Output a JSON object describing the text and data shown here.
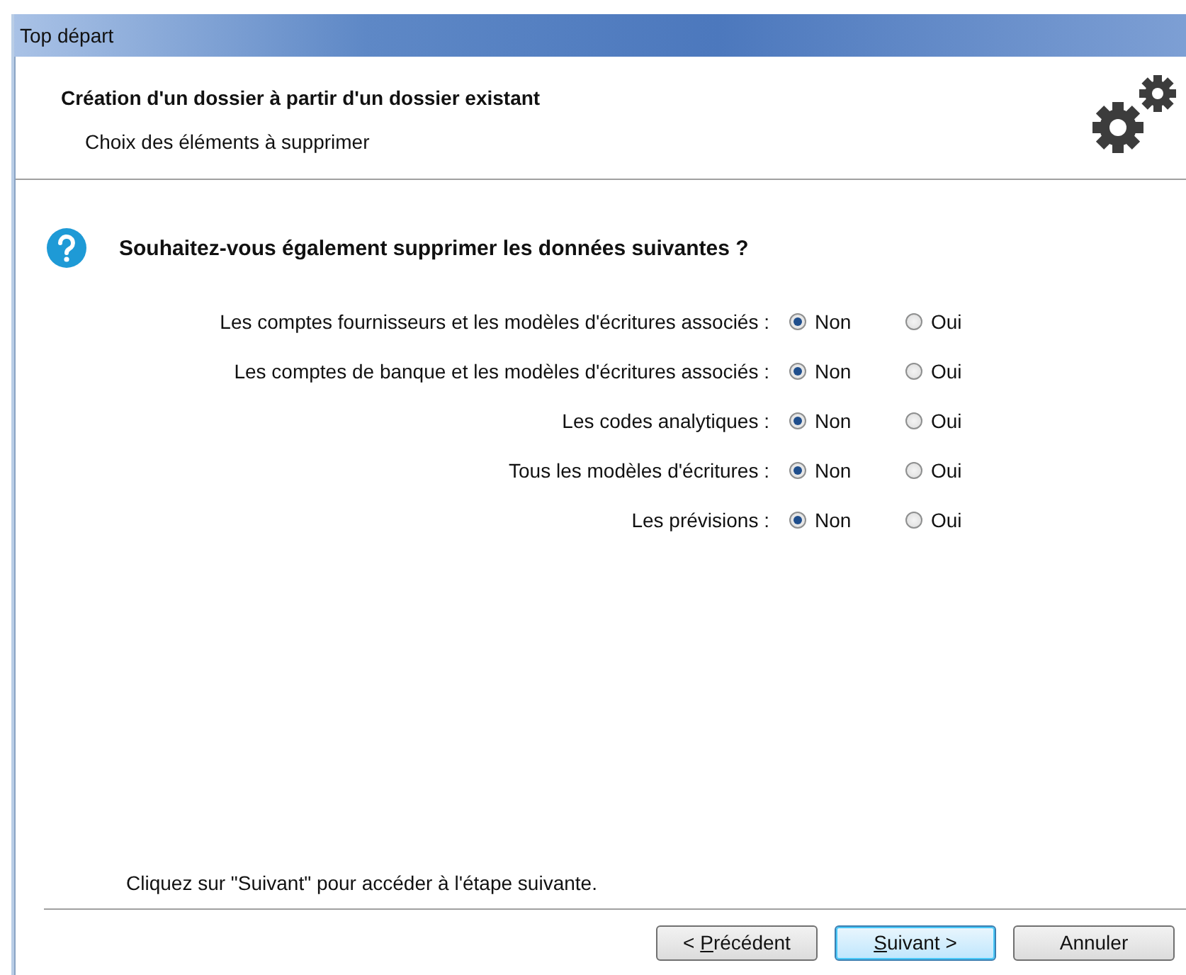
{
  "window": {
    "title": "Top départ"
  },
  "header": {
    "title": "Création d'un dossier à partir d'un dossier existant",
    "subtitle": "Choix des éléments à supprimer"
  },
  "question": "Souhaitez-vous également supprimer les données suivantes ?",
  "options": [
    {
      "label": "Les comptes fournisseurs et les modèles d'écritures associés :",
      "choices": [
        {
          "label": "Non",
          "selected": true
        },
        {
          "label": "Oui",
          "selected": false
        }
      ]
    },
    {
      "label": "Les comptes de banque et les modèles d'écritures associés :",
      "choices": [
        {
          "label": "Non",
          "selected": true
        },
        {
          "label": "Oui",
          "selected": false
        }
      ]
    },
    {
      "label": "Les codes analytiques :",
      "choices": [
        {
          "label": "Non",
          "selected": true
        },
        {
          "label": "Oui",
          "selected": false
        }
      ]
    },
    {
      "label": "Tous les modèles d'écritures :",
      "choices": [
        {
          "label": "Non",
          "selected": true
        },
        {
          "label": "Oui",
          "selected": false
        }
      ]
    },
    {
      "label": "Les prévisions :",
      "choices": [
        {
          "label": "Non",
          "selected": true
        },
        {
          "label": "Oui",
          "selected": false
        }
      ]
    }
  ],
  "hint": "Cliquez sur \"Suivant\" pour accéder à l'étape suivante.",
  "buttons": [
    {
      "before": "< ",
      "key": "P",
      "after": "récédent",
      "default": false
    },
    {
      "key": "S",
      "after": "uivant >",
      "default": true
    },
    {
      "before": "Annuler",
      "default": false
    }
  ]
}
